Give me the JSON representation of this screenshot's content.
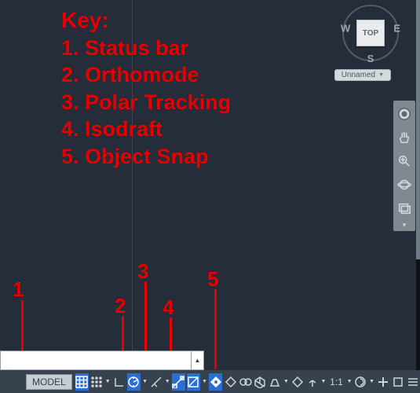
{
  "key": {
    "title": "Key:",
    "items": [
      "1. Status bar",
      "2. Orthomode",
      "3. Polar Tracking",
      "4. Isodraft",
      "5. Object Snap"
    ]
  },
  "viewcube": {
    "face": "TOP",
    "w": "W",
    "e": "E",
    "s": "S"
  },
  "wcs": {
    "label": "Unnamed"
  },
  "statusbar": {
    "model": "MODEL",
    "scale": "1:1"
  },
  "callouts": {
    "c1": "1",
    "c2": "2",
    "c3": "3",
    "c4": "4",
    "c5": "5"
  }
}
